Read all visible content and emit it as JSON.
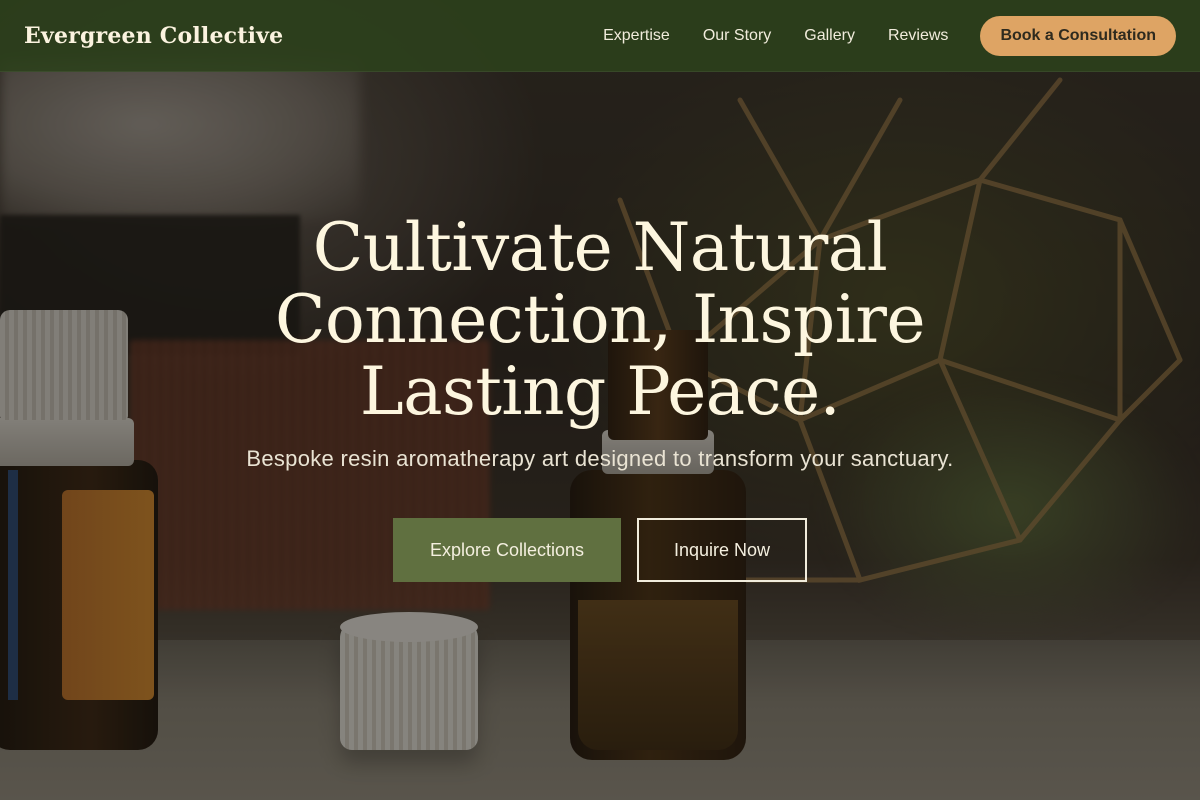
{
  "nav": {
    "brand": "Evergreen Collective",
    "links": [
      "Expertise",
      "Our Story",
      "Gallery",
      "Reviews"
    ],
    "cta": "Book a Consultation"
  },
  "hero": {
    "title": "Cultivate Natural Connection, Inspire Lasting Peace.",
    "subtitle": "Bespoke resin aromatherapy art designed to transform your sanctuary.",
    "primary_button": "Explore Collections",
    "secondary_button": "Inquire Now"
  },
  "colors": {
    "nav_bg": "#2c401c",
    "accent": "#dea464",
    "primary_button": "#607040",
    "text_light": "#fdf6df"
  }
}
